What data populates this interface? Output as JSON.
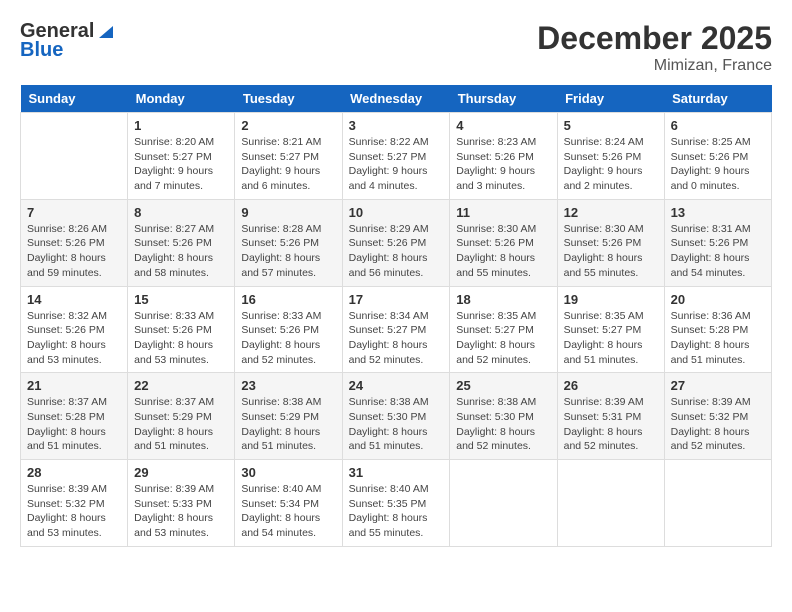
{
  "header": {
    "logo_general": "General",
    "logo_blue": "Blue",
    "month_title": "December 2025",
    "location": "Mimizan, France"
  },
  "days_of_week": [
    "Sunday",
    "Monday",
    "Tuesday",
    "Wednesday",
    "Thursday",
    "Friday",
    "Saturday"
  ],
  "weeks": [
    [
      {
        "day": "",
        "info": ""
      },
      {
        "day": "1",
        "info": "Sunrise: 8:20 AM\nSunset: 5:27 PM\nDaylight: 9 hours\nand 7 minutes."
      },
      {
        "day": "2",
        "info": "Sunrise: 8:21 AM\nSunset: 5:27 PM\nDaylight: 9 hours\nand 6 minutes."
      },
      {
        "day": "3",
        "info": "Sunrise: 8:22 AM\nSunset: 5:27 PM\nDaylight: 9 hours\nand 4 minutes."
      },
      {
        "day": "4",
        "info": "Sunrise: 8:23 AM\nSunset: 5:26 PM\nDaylight: 9 hours\nand 3 minutes."
      },
      {
        "day": "5",
        "info": "Sunrise: 8:24 AM\nSunset: 5:26 PM\nDaylight: 9 hours\nand 2 minutes."
      },
      {
        "day": "6",
        "info": "Sunrise: 8:25 AM\nSunset: 5:26 PM\nDaylight: 9 hours\nand 0 minutes."
      }
    ],
    [
      {
        "day": "7",
        "info": "Sunrise: 8:26 AM\nSunset: 5:26 PM\nDaylight: 8 hours\nand 59 minutes."
      },
      {
        "day": "8",
        "info": "Sunrise: 8:27 AM\nSunset: 5:26 PM\nDaylight: 8 hours\nand 58 minutes."
      },
      {
        "day": "9",
        "info": "Sunrise: 8:28 AM\nSunset: 5:26 PM\nDaylight: 8 hours\nand 57 minutes."
      },
      {
        "day": "10",
        "info": "Sunrise: 8:29 AM\nSunset: 5:26 PM\nDaylight: 8 hours\nand 56 minutes."
      },
      {
        "day": "11",
        "info": "Sunrise: 8:30 AM\nSunset: 5:26 PM\nDaylight: 8 hours\nand 55 minutes."
      },
      {
        "day": "12",
        "info": "Sunrise: 8:30 AM\nSunset: 5:26 PM\nDaylight: 8 hours\nand 55 minutes."
      },
      {
        "day": "13",
        "info": "Sunrise: 8:31 AM\nSunset: 5:26 PM\nDaylight: 8 hours\nand 54 minutes."
      }
    ],
    [
      {
        "day": "14",
        "info": "Sunrise: 8:32 AM\nSunset: 5:26 PM\nDaylight: 8 hours\nand 53 minutes."
      },
      {
        "day": "15",
        "info": "Sunrise: 8:33 AM\nSunset: 5:26 PM\nDaylight: 8 hours\nand 53 minutes."
      },
      {
        "day": "16",
        "info": "Sunrise: 8:33 AM\nSunset: 5:26 PM\nDaylight: 8 hours\nand 52 minutes."
      },
      {
        "day": "17",
        "info": "Sunrise: 8:34 AM\nSunset: 5:27 PM\nDaylight: 8 hours\nand 52 minutes."
      },
      {
        "day": "18",
        "info": "Sunrise: 8:35 AM\nSunset: 5:27 PM\nDaylight: 8 hours\nand 52 minutes."
      },
      {
        "day": "19",
        "info": "Sunrise: 8:35 AM\nSunset: 5:27 PM\nDaylight: 8 hours\nand 51 minutes."
      },
      {
        "day": "20",
        "info": "Sunrise: 8:36 AM\nSunset: 5:28 PM\nDaylight: 8 hours\nand 51 minutes."
      }
    ],
    [
      {
        "day": "21",
        "info": "Sunrise: 8:37 AM\nSunset: 5:28 PM\nDaylight: 8 hours\nand 51 minutes."
      },
      {
        "day": "22",
        "info": "Sunrise: 8:37 AM\nSunset: 5:29 PM\nDaylight: 8 hours\nand 51 minutes."
      },
      {
        "day": "23",
        "info": "Sunrise: 8:38 AM\nSunset: 5:29 PM\nDaylight: 8 hours\nand 51 minutes."
      },
      {
        "day": "24",
        "info": "Sunrise: 8:38 AM\nSunset: 5:30 PM\nDaylight: 8 hours\nand 51 minutes."
      },
      {
        "day": "25",
        "info": "Sunrise: 8:38 AM\nSunset: 5:30 PM\nDaylight: 8 hours\nand 52 minutes."
      },
      {
        "day": "26",
        "info": "Sunrise: 8:39 AM\nSunset: 5:31 PM\nDaylight: 8 hours\nand 52 minutes."
      },
      {
        "day": "27",
        "info": "Sunrise: 8:39 AM\nSunset: 5:32 PM\nDaylight: 8 hours\nand 52 minutes."
      }
    ],
    [
      {
        "day": "28",
        "info": "Sunrise: 8:39 AM\nSunset: 5:32 PM\nDaylight: 8 hours\nand 53 minutes."
      },
      {
        "day": "29",
        "info": "Sunrise: 8:39 AM\nSunset: 5:33 PM\nDaylight: 8 hours\nand 53 minutes."
      },
      {
        "day": "30",
        "info": "Sunrise: 8:40 AM\nSunset: 5:34 PM\nDaylight: 8 hours\nand 54 minutes."
      },
      {
        "day": "31",
        "info": "Sunrise: 8:40 AM\nSunset: 5:35 PM\nDaylight: 8 hours\nand 55 minutes."
      },
      {
        "day": "",
        "info": ""
      },
      {
        "day": "",
        "info": ""
      },
      {
        "day": "",
        "info": ""
      }
    ]
  ]
}
